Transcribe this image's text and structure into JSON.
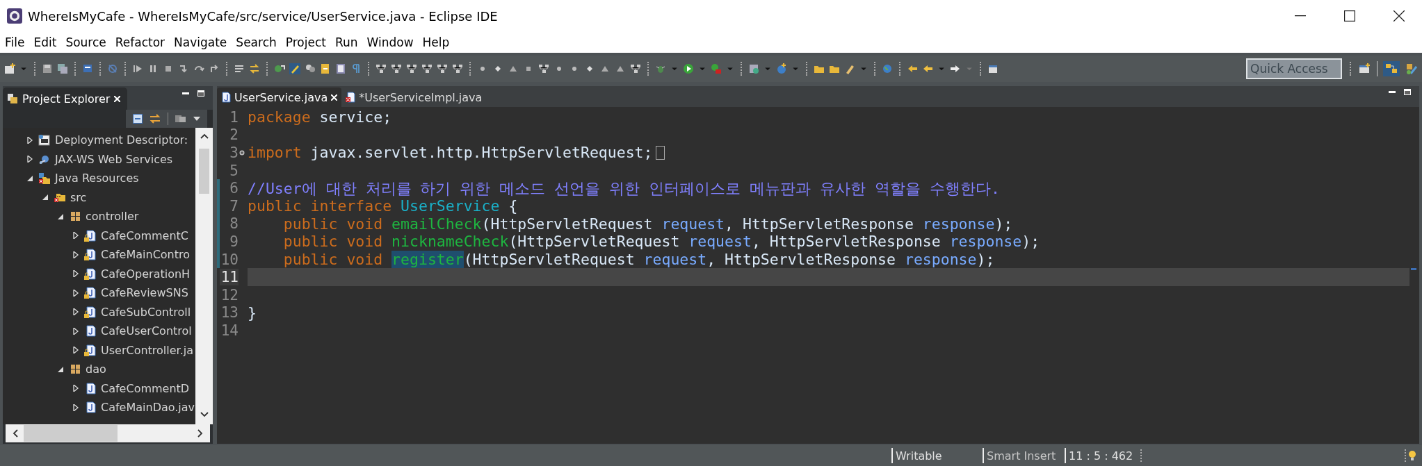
{
  "window": {
    "title": "WhereIsMyCafe - WhereIsMyCafe/src/service/UserService.java - Eclipse IDE"
  },
  "menu": [
    {
      "label": "File"
    },
    {
      "label": "Edit"
    },
    {
      "label": "Source"
    },
    {
      "label": "Refactor"
    },
    {
      "label": "Navigate"
    },
    {
      "label": "Search"
    },
    {
      "label": "Project"
    },
    {
      "label": "Run"
    },
    {
      "label": "Window"
    },
    {
      "label": "Help"
    }
  ],
  "quick_access": {
    "placeholder": "Quick Access"
  },
  "explorer": {
    "title": "Project Explorer",
    "tree": [
      {
        "label": "Deployment Descriptor:",
        "kind": "descriptor",
        "expanded": false
      },
      {
        "label": "JAX-WS Web Services",
        "kind": "webservices",
        "expanded": false
      },
      {
        "label": "Java Resources",
        "kind": "resources",
        "expanded": true,
        "children": [
          {
            "label": "src",
            "kind": "source-folder",
            "expanded": true,
            "children": [
              {
                "label": "controller",
                "kind": "package",
                "expanded": true,
                "children": [
                  {
                    "label": "CafeCommentC",
                    "kind": "java-file",
                    "locked": true,
                    "expanded": false
                  },
                  {
                    "label": "CafeMainContro",
                    "kind": "java-file",
                    "locked": true,
                    "expanded": false
                  },
                  {
                    "label": "CafeOperationH",
                    "kind": "java-file",
                    "locked": true,
                    "expanded": false
                  },
                  {
                    "label": "CafeReviewSNS",
                    "kind": "java-file",
                    "locked": true,
                    "expanded": false
                  },
                  {
                    "label": "CafeSubControll",
                    "kind": "java-file",
                    "locked": true,
                    "expanded": false
                  },
                  {
                    "label": "CafeUserControl",
                    "kind": "java-file",
                    "locked": false,
                    "expanded": false
                  },
                  {
                    "label": "UserController.ja",
                    "kind": "java-file",
                    "locked": true,
                    "expanded": false
                  }
                ]
              },
              {
                "label": "dao",
                "kind": "package",
                "expanded": true,
                "children": [
                  {
                    "label": "CafeCommentD",
                    "kind": "java-file",
                    "locked": false,
                    "expanded": false
                  },
                  {
                    "label": "CafeMainDao.jav",
                    "kind": "java-file",
                    "locked": false,
                    "expanded": false
                  }
                ]
              }
            ]
          }
        ]
      }
    ]
  },
  "editor": {
    "tabs": [
      {
        "label": "UserService.java",
        "selected": true,
        "kind": "java"
      },
      {
        "label": "*UserServiceImpl.java",
        "selected": false,
        "kind": "java-error"
      }
    ],
    "lines": [
      {
        "number": "1",
        "changed": false,
        "current": false,
        "folded": false,
        "tokens": [
          {
            "text": "package",
            "kind": "keyword"
          },
          {
            "text": " service;",
            "kind": "plain"
          }
        ]
      },
      {
        "number": "2",
        "changed": false,
        "current": false,
        "folded": false
      },
      {
        "number": "3",
        "changed": false,
        "current": false,
        "folded": true,
        "tokens": [
          {
            "text": "import",
            "kind": "keyword"
          },
          {
            "text": " javax.servlet.http.HttpServletRequest;",
            "kind": "plain"
          }
        ]
      },
      {
        "number": "5",
        "changed": false,
        "current": false,
        "folded": false
      },
      {
        "number": "6",
        "changed": true,
        "current": false,
        "folded": false,
        "tokens": [
          {
            "text": "//User에 대한 처리를 하기 위한 메소드 선언을 위한 인터페이스로 메뉴판과 유사한 역할을 수행한다.",
            "kind": "comment"
          }
        ]
      },
      {
        "number": "7",
        "changed": true,
        "current": false,
        "folded": false,
        "tokens": [
          {
            "text": "public interface ",
            "kind": "keyword"
          },
          {
            "text": "UserService",
            "kind": "interface"
          },
          {
            "text": " {",
            "kind": "plain"
          }
        ]
      },
      {
        "number": "8",
        "changed": true,
        "current": false,
        "folded": false,
        "tokens": [
          {
            "text": "    public void ",
            "kind": "keyword"
          },
          {
            "text": "emailCheck",
            "kind": "method"
          },
          {
            "text": "(HttpServletRequest ",
            "kind": "plain"
          },
          {
            "text": "request",
            "kind": "param"
          },
          {
            "text": ", HttpServletResponse ",
            "kind": "plain"
          },
          {
            "text": "response",
            "kind": "param"
          },
          {
            "text": ");",
            "kind": "plain"
          }
        ]
      },
      {
        "number": "9",
        "changed": true,
        "current": false,
        "folded": false,
        "tokens": [
          {
            "text": "    public void ",
            "kind": "keyword"
          },
          {
            "text": "nicknameCheck",
            "kind": "method"
          },
          {
            "text": "(HttpServletRequest ",
            "kind": "plain"
          },
          {
            "text": "request",
            "kind": "param"
          },
          {
            "text": ", HttpServletResponse ",
            "kind": "plain"
          },
          {
            "text": "response",
            "kind": "param"
          },
          {
            "text": ");",
            "kind": "plain"
          }
        ]
      },
      {
        "number": "10",
        "changed": true,
        "current": false,
        "folded": false,
        "tokens": [
          {
            "text": "    public void ",
            "kind": "keyword"
          },
          {
            "text": "register",
            "kind": "method",
            "highlighted": true
          },
          {
            "text": "(HttpServletRequest ",
            "kind": "plain"
          },
          {
            "text": "request",
            "kind": "param"
          },
          {
            "text": ", HttpServletResponse ",
            "kind": "plain"
          },
          {
            "text": "response",
            "kind": "param"
          },
          {
            "text": ");",
            "kind": "plain"
          }
        ]
      },
      {
        "number": "11",
        "changed": false,
        "current": true,
        "folded": false
      },
      {
        "number": "12",
        "changed": false,
        "current": false,
        "folded": false
      },
      {
        "number": "13",
        "changed": false,
        "current": false,
        "folded": false,
        "tokens": [
          {
            "text": "}",
            "kind": "plain"
          }
        ]
      },
      {
        "number": "14",
        "changed": false,
        "current": false,
        "folded": false
      }
    ]
  },
  "status_bar": [
    {
      "text": "Writable"
    },
    {
      "text": "Smart Insert"
    },
    {
      "text": "11 : 5 : 462"
    }
  ]
}
